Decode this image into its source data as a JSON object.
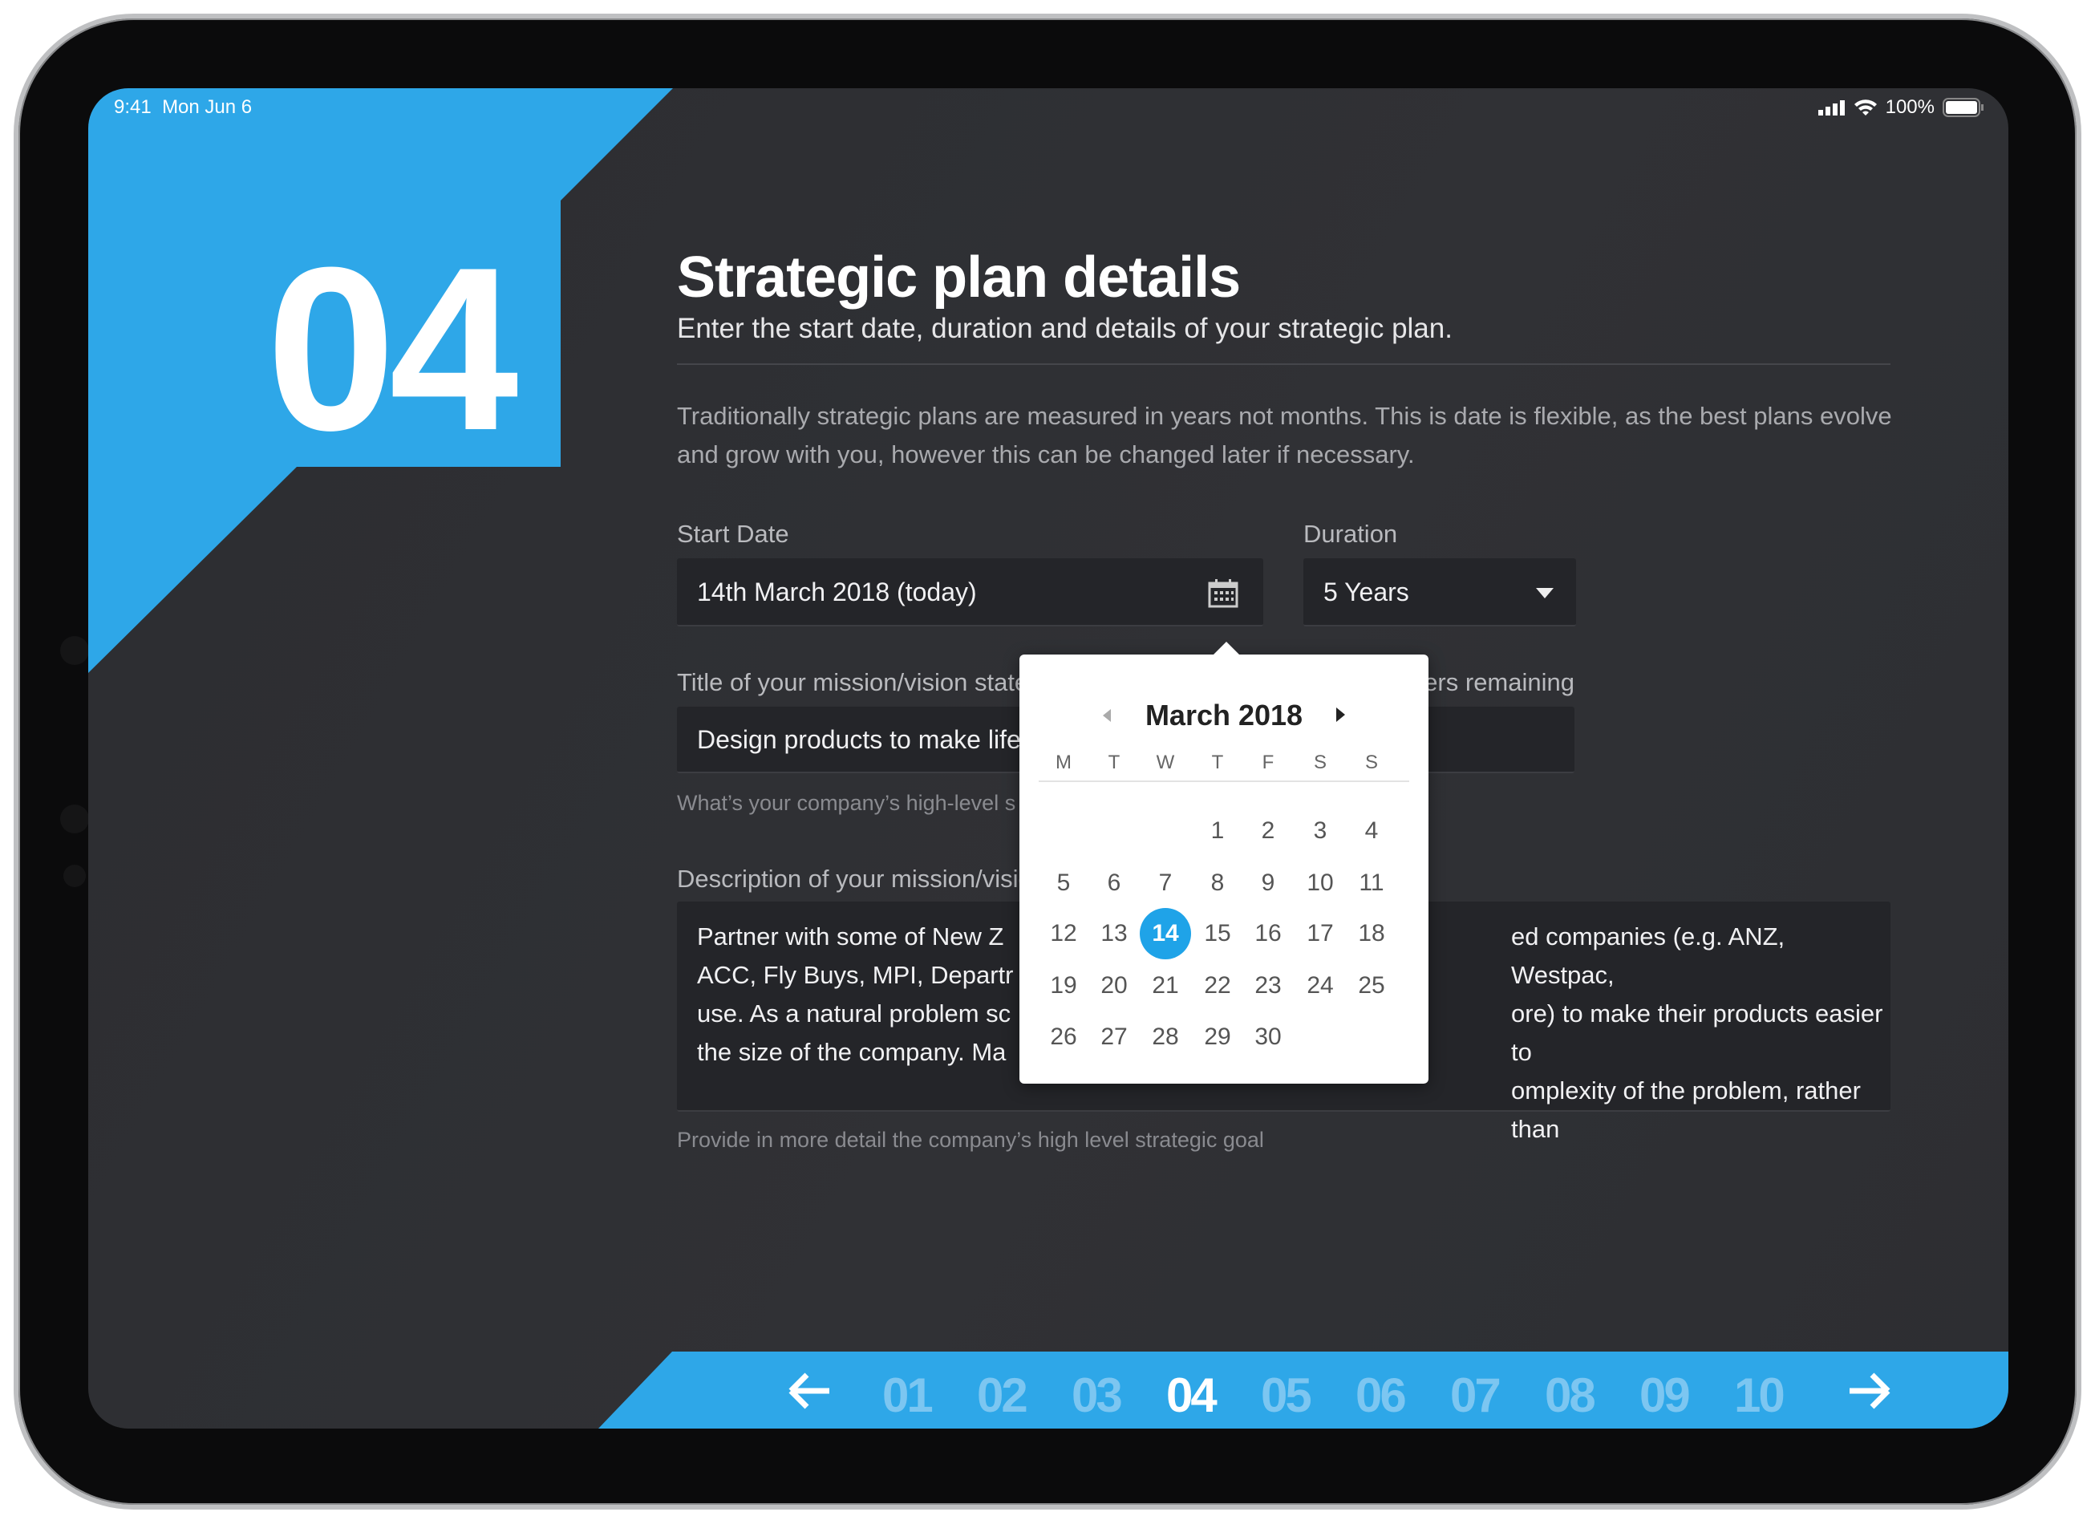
{
  "status_bar": {
    "time": "9:41",
    "date": "Mon Jun 6",
    "battery": "100%"
  },
  "step_number": "04",
  "header": {
    "title": "Strategic plan details",
    "subtitle": "Enter the start date, duration and details of your strategic plan."
  },
  "intro": "Traditionally strategic plans are measured in years not months. This is date is flexible, as the best plans evolve and grow with you, however this can be changed later if necessary.",
  "start_date": {
    "label": "Start Date",
    "value": "14th March 2018 (today)",
    "icon": "calendar-icon"
  },
  "duration": {
    "label": "Duration",
    "value": "5 Years",
    "icon": "dropdown-caret-icon"
  },
  "mission_title": {
    "label_visible": "Title of your mission/vision state",
    "counter_visible": "ers remaining",
    "value_visible": "Design products to make life",
    "hint_visible": "What’s your company’s high-level s"
  },
  "description": {
    "label_visible": "Description of your mission/visio",
    "lines_left": [
      "Partner with some of New Z",
      "ACC, Fly Buys, MPI, Departr",
      "use. As a natural problem sc",
      "the size of the company. Ma"
    ],
    "lines_right": [
      "ed companies (e.g. ANZ, Westpac,",
      "ore) to make their products easier to",
      "omplexity of the problem, rather than",
      ""
    ],
    "hint": "Provide in more detail the company’s high level strategic goal"
  },
  "calendar": {
    "month": "March 2018",
    "weekdays": [
      "M",
      "T",
      "W",
      "T",
      "F",
      "S",
      "S"
    ],
    "first_weekday_index": 3,
    "days_in_month": 30,
    "selected_day": 14,
    "accent": "#1fa3e8"
  },
  "pagination": {
    "pages": [
      "01",
      "02",
      "03",
      "04",
      "05",
      "06",
      "07",
      "08",
      "09",
      "10"
    ],
    "current": "04",
    "prev_icon": "arrow-left-icon",
    "next_icon": "arrow-right-icon"
  },
  "colors": {
    "accent": "#2ea7e8",
    "background": "#2f3034"
  }
}
